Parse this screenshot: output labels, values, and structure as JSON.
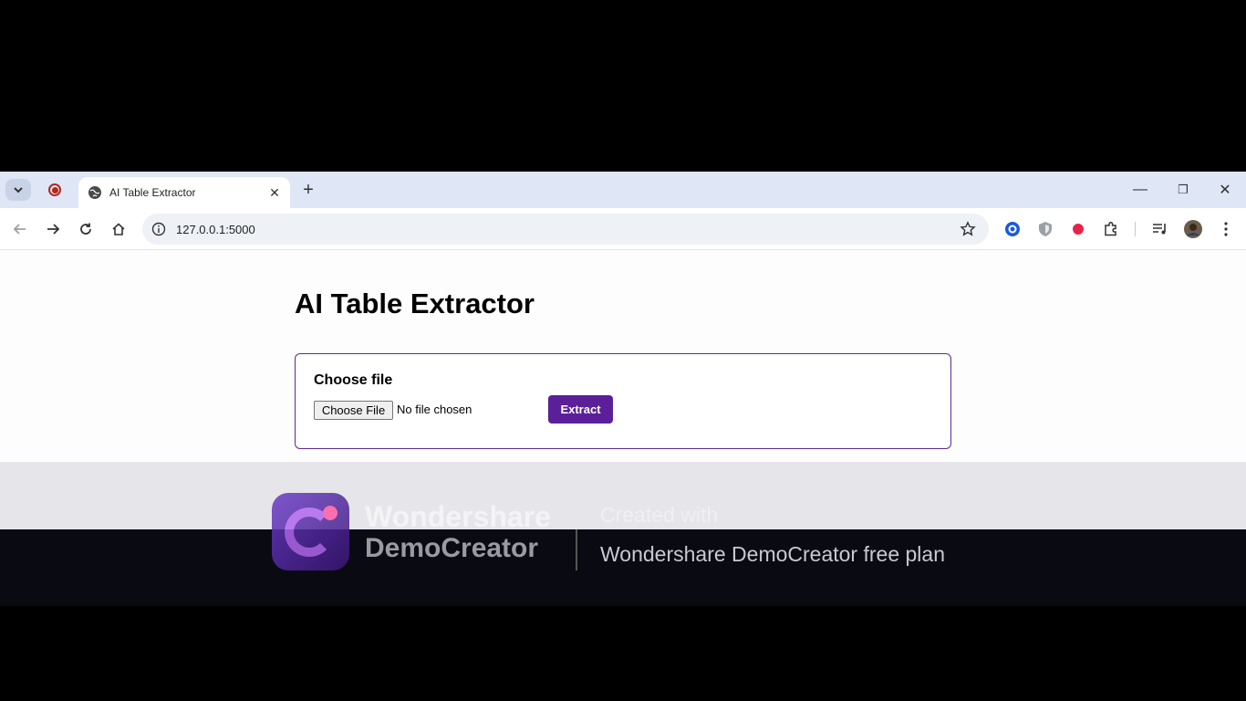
{
  "browser": {
    "tab": {
      "title": "AI Table Extractor",
      "close_glyph": "✕"
    },
    "new_tab_glyph": "+",
    "window_controls": {
      "minimize": "—",
      "restore": "❐",
      "close": "✕"
    },
    "address": "127.0.0.1:5000",
    "icons": [
      "tab-search-icon",
      "record-icon",
      "globe-icon",
      "back-arrow-icon",
      "forward-arrow-icon",
      "reload-icon",
      "home-icon",
      "site-info-icon",
      "bookmark-star-icon",
      "extension-circle-icon",
      "shield-extension-icon",
      "red-dot-extension-icon",
      "extensions-puzzle-icon",
      "media-controls-icon",
      "profile-avatar-icon",
      "kebab-menu-icon"
    ]
  },
  "page": {
    "title": "AI Table Extractor",
    "form": {
      "label": "Choose file",
      "file_button": "Choose File",
      "file_status": "No file chosen",
      "submit": "Extract"
    }
  },
  "watermark": {
    "brand_line1": "Wondershare",
    "brand_line2": "DemoCreator",
    "created": "Created with",
    "plan": "Wondershare DemoCreator free plan"
  },
  "colors": {
    "accent": "#5b1f9a",
    "card_border": "#5b2b91",
    "tabstrip": "#dfe6f5"
  }
}
